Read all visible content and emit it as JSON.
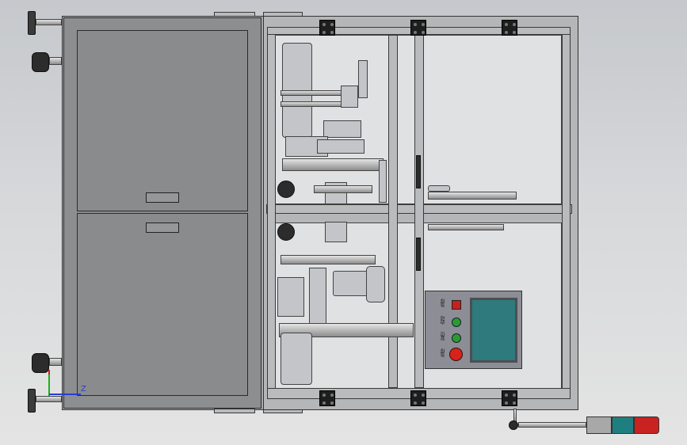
{
  "viewport": {
    "axis_label": "Z"
  },
  "machine": {
    "left_cabinet": {
      "upper_door": "closed",
      "lower_door": "closed"
    },
    "control_panel": {
      "buttons": [
        {
          "label": "急停",
          "type": "square",
          "color": "#c8201c"
        },
        {
          "label": "启动",
          "type": "round",
          "color": "#2e9a2e"
        },
        {
          "label": "复位",
          "type": "round",
          "color": "#2e9a2e"
        },
        {
          "label": "急停",
          "type": "round",
          "color": "#d8231b"
        }
      ],
      "screen_color": "#2e7a7d"
    },
    "signal_tower": {
      "segments": [
        "#a8a8a8",
        "#1f7f80",
        "#c92222"
      ]
    }
  },
  "colors": {
    "background_top": "#c5c8cc",
    "background_bottom": "#e4e4e4",
    "frame": "#a8aaac",
    "bracket": "#1e1e1e"
  }
}
